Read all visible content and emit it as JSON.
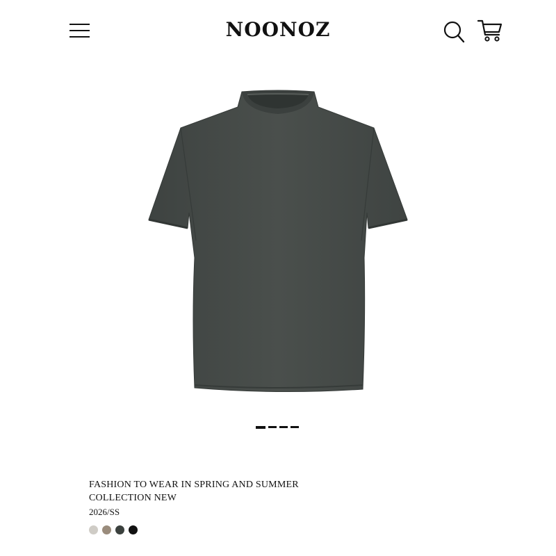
{
  "header": {
    "brand": "NOONOZ",
    "icons": {
      "menu": "hamburger-menu-icon",
      "search": "search-icon",
      "cart": "shopping-cart-icon"
    }
  },
  "product": {
    "image": {
      "subject": "short-sleeve crew-neck t-shirt",
      "color": "#454a47"
    },
    "gallery": {
      "total": 4,
      "current": 1
    },
    "title_line1": "FASHION TO WEAR IN SPRING AND SUMMER",
    "title_line2": "COLLECTION NEW",
    "season": "2026/SS",
    "swatches": [
      "#cfccc6",
      "#9a8c7c",
      "#3b413e",
      "#111111"
    ]
  }
}
